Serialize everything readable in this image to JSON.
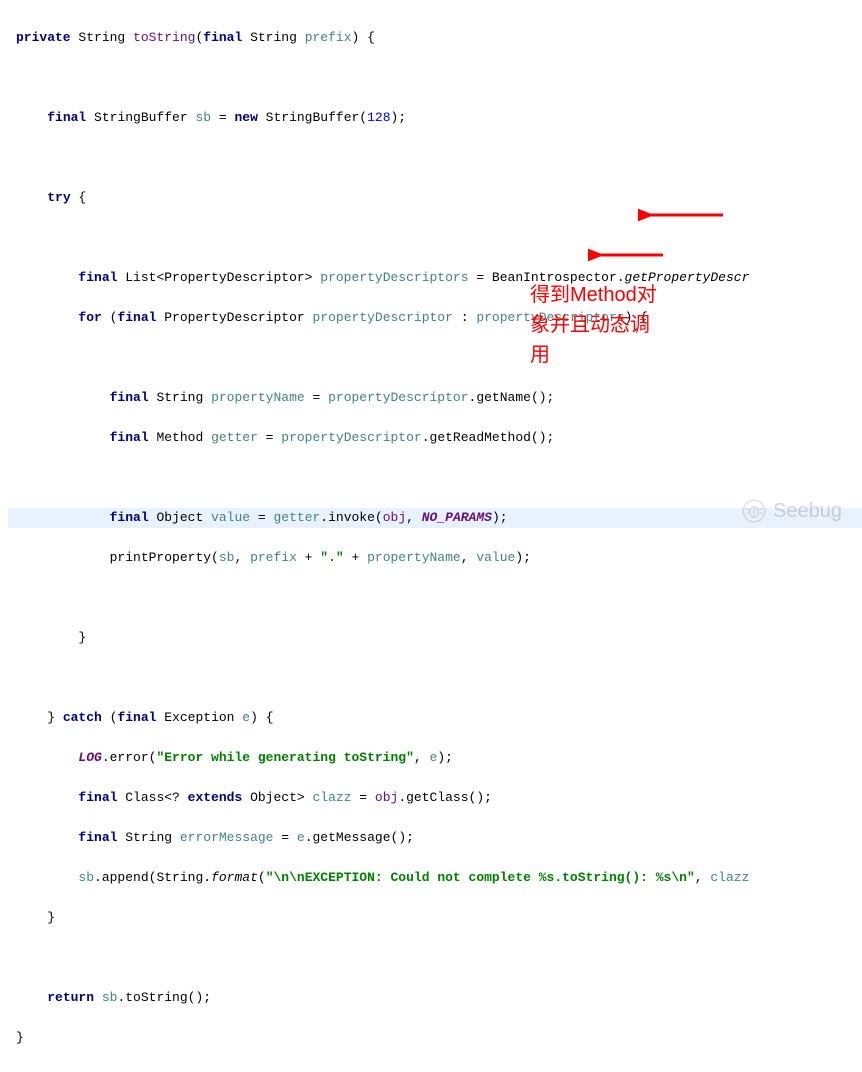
{
  "annotation": {
    "line1": "得到Method对",
    "line2": "象并且动态调",
    "line3": "用"
  },
  "watermark": "Seebug",
  "code": {
    "l1_kw1": "private",
    "l1_t1": " String ",
    "l1_name": "toString",
    "l1_t2": "(",
    "l1_kw2": "final",
    "l1_t3": " String ",
    "l1_param": "prefix",
    "l1_t4": ") {",
    "l3_kw1": "final",
    "l3_t1": " StringBuffer ",
    "l3_var": "sb",
    "l3_t2": " = ",
    "l3_kw2": "new",
    "l3_t3": " StringBuffer(",
    "l3_num": "128",
    "l3_t4": ");",
    "l5_kw": "try",
    "l5_t": " {",
    "l7_kw1": "final",
    "l7_t1": " List<PropertyDescriptor> ",
    "l7_var": "propertyDescriptors",
    "l7_t2": " = BeanIntrospector.",
    "l7_m": "getPropertyDescr",
    "l8_kw1": "for",
    "l8_t1": " (",
    "l8_kw2": "final",
    "l8_t2": " PropertyDescriptor ",
    "l8_var1": "propertyDescriptor",
    "l8_t3": " : ",
    "l8_var2": "propertyDescriptors",
    "l8_t4": ") {",
    "l10_kw": "final",
    "l10_t1": " String ",
    "l10_var": "propertyName",
    "l10_t2": " = ",
    "l10_ref": "propertyDescriptor",
    "l10_t3": ".getName();",
    "l11_kw": "final",
    "l11_t1": " Method ",
    "l11_var": "getter",
    "l11_t2": " = ",
    "l11_ref": "propertyDescriptor",
    "l11_t3": ".getReadMethod();",
    "l13_kw": "final",
    "l13_t1": " Object ",
    "l13_var": "value",
    "l13_t2": " = ",
    "l13_ref1": "getter",
    "l13_t3": ".invoke(",
    "l13_ref2": "obj",
    "l13_t4": ", ",
    "l13_const": "NO_PARAMS",
    "l13_t5": ");",
    "l14_t1": "printProperty(",
    "l14_v1": "sb",
    "l14_t2": ", ",
    "l14_v2": "prefix",
    "l14_t3": " + ",
    "l14_str": "\".\"",
    "l14_t4": " + ",
    "l14_v3": "propertyName",
    "l14_t5": ", ",
    "l14_v4": "value",
    "l14_t6": ");",
    "l16": "}",
    "l18_t1": "} ",
    "l18_kw1": "catch",
    "l18_t2": " (",
    "l18_kw2": "final",
    "l18_t3": " Exception ",
    "l18_var": "e",
    "l18_t4": ") {",
    "l19_ref": "LOG",
    "l19_t1": ".error(",
    "l19_str": "\"Error while generating toString\"",
    "l19_t2": ", ",
    "l19_v": "e",
    "l19_t3": ");",
    "l20_kw1": "final",
    "l20_t1": " Class<? ",
    "l20_kw2": "extends",
    "l20_t2": " Object> ",
    "l20_var": "clazz",
    "l20_t3": " = ",
    "l20_ref": "obj",
    "l20_t4": ".getClass();",
    "l21_kw": "final",
    "l21_t1": " String ",
    "l21_var": "errorMessage",
    "l21_t2": " = ",
    "l21_ref": "e",
    "l21_t3": ".getMessage();",
    "l22_v1": "sb",
    "l22_t1": ".append(String.",
    "l22_m": "format",
    "l22_t2": "(",
    "l22_str": "\"\\n\\nEXCEPTION: Could not complete %s.toString(): %s\\n\"",
    "l22_t3": ", ",
    "l22_v2": "clazz",
    "l23": "}",
    "l25_kw": "return",
    "l25_t1": " ",
    "l25_v": "sb",
    "l25_t2": ".toString();",
    "l26": "}"
  }
}
